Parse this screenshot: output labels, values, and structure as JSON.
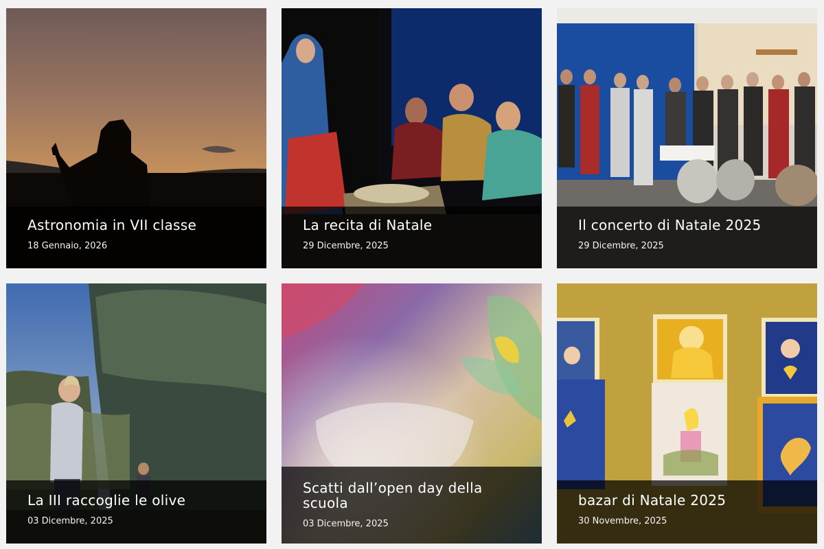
{
  "posts": [
    {
      "title": "Astronomia in VII classe",
      "date": "18 Gennaio, 2026"
    },
    {
      "title": "La recita di Natale",
      "date": "29 Dicembre, 2025"
    },
    {
      "title": "Il concerto di Natale 2025",
      "date": "29 Dicembre, 2025"
    },
    {
      "title": "La III raccoglie le olive",
      "date": "03 Dicembre, 2025"
    },
    {
      "title": "Scatti dall’open day della scuola",
      "date": "03 Dicembre, 2025"
    },
    {
      "title": "bazar di Natale 2025",
      "date": "30 Novembre, 2025"
    }
  ]
}
